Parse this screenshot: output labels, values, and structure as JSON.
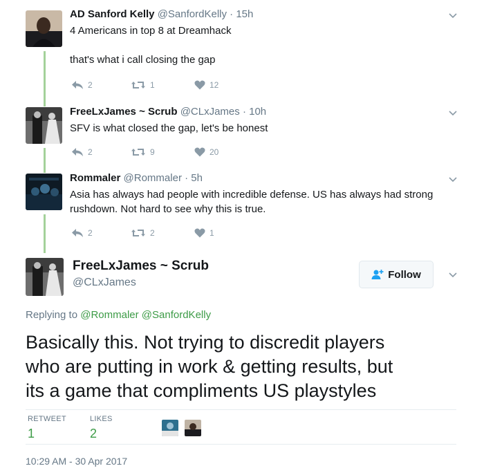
{
  "tweets": [
    {
      "name": "AD Sanford Kelly",
      "handle": "@SanfordKelly",
      "separator": "·",
      "time": "15h",
      "lines": [
        "4 Americans in top 8 at Dreamhack",
        "",
        "that's what i call closing the gap"
      ],
      "replies": "2",
      "retweets": "1",
      "likes": "12"
    },
    {
      "name": "FreeLxJames ~ Scrub",
      "handle": "@CLxJames",
      "separator": "·",
      "time": "10h",
      "lines": [
        "SFV is what closed the gap, let's be honest"
      ],
      "replies": "2",
      "retweets": "9",
      "likes": "20"
    },
    {
      "name": "Rommaler",
      "handle": "@Rommaler",
      "separator": "·",
      "time": "5h",
      "lines": [
        "Asia has always had people with incredible defense. US has always had strong",
        "rushdown. Not hard to see why this is true."
      ],
      "replies": "2",
      "retweets": "2",
      "likes": "1"
    }
  ],
  "main": {
    "name": "FreeLxJames ~ Scrub",
    "handle": "@CLxJames",
    "follow_label": "Follow",
    "replying_prefix": "Replying to",
    "replying_to": [
      "@Rommaler",
      "@SanfordKelly"
    ],
    "text_lines": [
      "Basically this. Not trying to discredit players",
      "who are putting in work & getting results, but",
      "its a game that compliments US playstyles"
    ],
    "retweet_label": "RETWEET",
    "retweet_count": "1",
    "likes_label": "LIKES",
    "likes_count": "2",
    "timestamp": "10:29 AM - 30 Apr 2017"
  },
  "icons": {
    "reply": "reply-icon",
    "retweet": "retweet-icon",
    "like": "heart-icon",
    "more": "chevron-down-icon",
    "follow": "add-user-icon"
  },
  "colors": {
    "accent_green": "#3c9b46",
    "thread_line": "#a4d19a",
    "muted": "#657786",
    "action_grey": "#8a9aa6"
  }
}
